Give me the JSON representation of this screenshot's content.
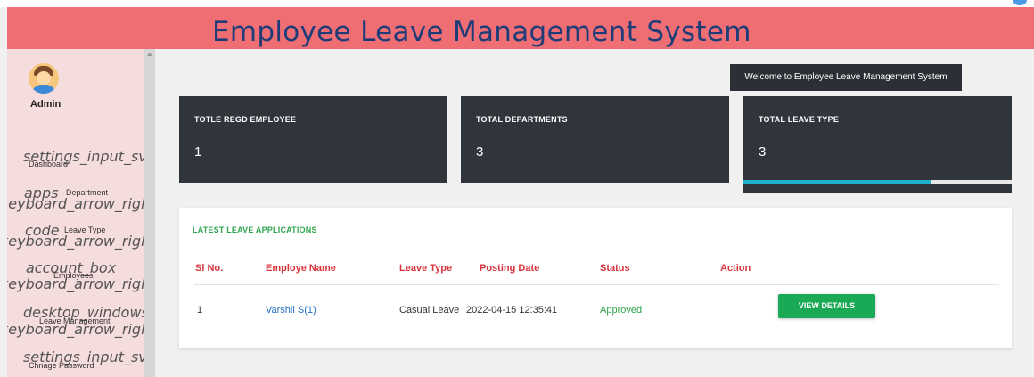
{
  "header": {
    "title": "Employee Leave Management System"
  },
  "sidebar": {
    "user_label": "Admin",
    "items": [
      {
        "icon_text": "settings_input_svideo",
        "label": "Dashboard",
        "arrow_text": ""
      },
      {
        "icon_text": "apps",
        "label": "Department",
        "arrow_text": "keyboard_arrow_right"
      },
      {
        "icon_text": "code",
        "label": "Leave Type",
        "arrow_text": "keyboard_arrow_right"
      },
      {
        "icon_text": "account_box",
        "label": "Employees",
        "arrow_text": "keyboard_arrow_right"
      },
      {
        "icon_text": "desktop_windows",
        "label": "Leave Management",
        "arrow_text": "keyboard_arrow_right"
      },
      {
        "icon_text": "settings_input_svideo",
        "label": "Chnage Password",
        "arrow_text": ""
      }
    ]
  },
  "welcome": {
    "text": "Welcome to Employee Leave Management System"
  },
  "stats": [
    {
      "label": "TOTLE REGD EMPLOYEE",
      "value": "1"
    },
    {
      "label": "TOTAL DEPARTMENTS",
      "value": "3"
    },
    {
      "label": "TOTAL LEAVE TYPE",
      "value": "3"
    }
  ],
  "leave_type_progress": 0.7,
  "latest": {
    "title": "LATEST LEAVE APPLICATIONS",
    "columns": [
      "Sl No.",
      "Employe Name",
      "Leave Type",
      "Posting Date",
      "Status",
      "Action"
    ],
    "rows": [
      {
        "sl": "1",
        "name": "Varshil S(1)",
        "leave_type": "Casual Leave",
        "posting_date": "2022-04-15 12:35:41",
        "status": "Approved",
        "action_label": "VIEW DETAILS"
      }
    ]
  },
  "colors": {
    "header": "#ef6e73",
    "title": "#1e3c78",
    "card": "#30343b",
    "accent": "#1aaa55",
    "column_header": "#d8343d"
  }
}
